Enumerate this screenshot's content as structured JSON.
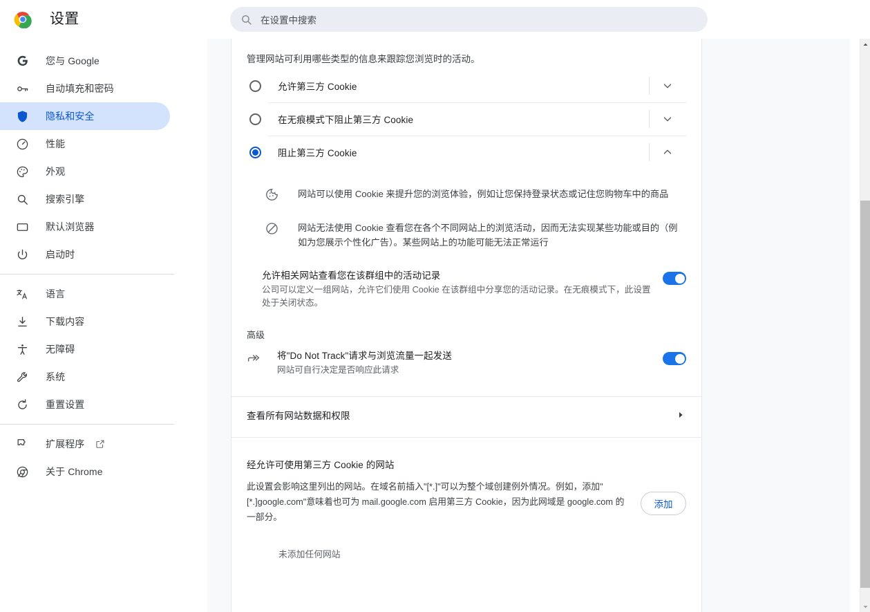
{
  "header": {
    "title": "设置",
    "logo_icon": "chrome-logo",
    "search": {
      "icon": "search-icon",
      "placeholder": "在设置中搜索",
      "value": ""
    }
  },
  "sidebar": {
    "groups": [
      {
        "items": [
          {
            "id": "you-and-google",
            "icon": "google-g-icon",
            "label": "您与 Google",
            "active": false
          },
          {
            "id": "autofill-passwords",
            "icon": "key-icon",
            "label": "自动填充和密码",
            "active": false
          },
          {
            "id": "privacy-security",
            "icon": "shield-icon",
            "label": "隐私和安全",
            "active": true
          },
          {
            "id": "performance",
            "icon": "speedometer-icon",
            "label": "性能",
            "active": false
          },
          {
            "id": "appearance",
            "icon": "palette-icon",
            "label": "外观",
            "active": false
          },
          {
            "id": "search-engine",
            "icon": "magnifier-icon",
            "label": "搜索引擎",
            "active": false
          },
          {
            "id": "default-browser",
            "icon": "window-icon",
            "label": "默认浏览器",
            "active": false
          },
          {
            "id": "on-startup",
            "icon": "power-icon",
            "label": "启动时",
            "active": false
          }
        ]
      },
      {
        "items": [
          {
            "id": "languages",
            "icon": "translate-icon",
            "label": "语言",
            "active": false
          },
          {
            "id": "downloads",
            "icon": "download-icon",
            "label": "下载内容",
            "active": false
          },
          {
            "id": "accessibility",
            "icon": "accessibility-icon",
            "label": "无障碍",
            "active": false
          },
          {
            "id": "system",
            "icon": "wrench-icon",
            "label": "系统",
            "active": false
          },
          {
            "id": "reset-settings",
            "icon": "restore-icon",
            "label": "重置设置",
            "active": false
          }
        ]
      },
      {
        "items": [
          {
            "id": "extensions",
            "icon": "puzzle-icon",
            "label": "扩展程序",
            "active": false,
            "external": true,
            "external_icon": "external-link-icon"
          },
          {
            "id": "about-chrome",
            "icon": "chrome-outline-icon",
            "label": "关于 Chrome",
            "active": false
          }
        ]
      }
    ]
  },
  "main": {
    "intro": "管理网站可利用哪些类型的信息来跟踪您浏览时的活动。",
    "cookie_options": [
      {
        "id": "allow-third-party",
        "label": "允许第三方 Cookie",
        "selected": false,
        "expanded": false,
        "chevron": "chevron-down-icon"
      },
      {
        "id": "block-third-party-incognito",
        "label": "在无痕模式下阻止第三方 Cookie",
        "selected": false,
        "expanded": false,
        "chevron": "chevron-down-icon"
      },
      {
        "id": "block-third-party",
        "label": "阻止第三方 Cookie",
        "selected": true,
        "expanded": true,
        "chevron": "chevron-up-icon"
      }
    ],
    "expanded_details": [
      {
        "icon": "cookie-icon",
        "text": "网站可以使用 Cookie 来提升您的浏览体验，例如让您保持登录状态或记住您购物车中的商品"
      },
      {
        "icon": "block-icon",
        "text": "网站无法使用 Cookie 查看您在各个不同网站上的浏览活动，因而无法实现某些功能或目的（例如为您展示个性化广告）。某些网站上的功能可能无法正常运行"
      }
    ],
    "related_sites": {
      "title": "允许相关网站查看您在该群组中的活动记录",
      "subtitle": "公司可以定义一组网站，允许它们使用 Cookie 在该群组中分享您的活动记录。在无痕模式下，此设置处于关闭状态。",
      "toggle_on": true
    },
    "advanced_label": "高级",
    "do_not_track": {
      "icon": "forward-arrows-icon",
      "title": "将\"Do Not Track\"请求与浏览流量一起发送",
      "subtitle": "网站可自行决定是否响应此请求",
      "toggle_on": true
    },
    "all_site_data": {
      "label": "查看所有网站数据和权限",
      "arrow_icon": "arrow-right-icon"
    },
    "exceptions": {
      "title": "经允许可使用第三方 Cookie 的网站",
      "description": "此设置会影响这里列出的网站。在域名前插入\"[*.]\"可以为整个域创建例外情况。例如，添加\"[*.]google.com\"意味着也可为 mail.google.com 启用第三方 Cookie，因为此网域是 google.com 的一部分。",
      "add_button": "添加",
      "empty_text": "未添加任何网站"
    }
  },
  "scrollbar": {
    "up_icon": "scroll-up-arrow-icon",
    "down_icon": "scroll-down-arrow-icon"
  },
  "colors": {
    "accent": "#0b57d0",
    "toggle_on": "#1a73e8",
    "active_nav_bg": "#d3e3fd",
    "panel_bg": "#f8f9fa",
    "search_bg": "#eaedf3"
  }
}
